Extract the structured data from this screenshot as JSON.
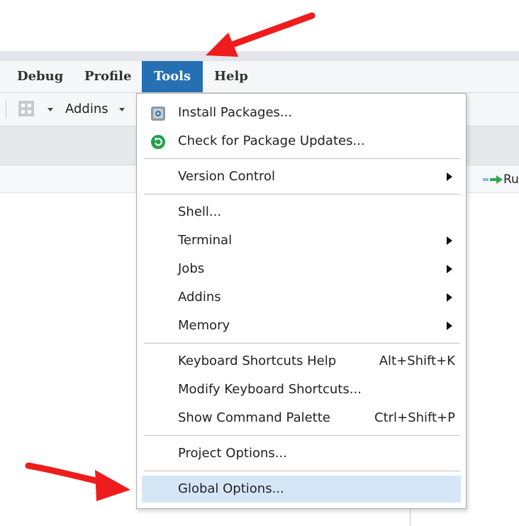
{
  "menubar": {
    "items": [
      {
        "label": "Debug"
      },
      {
        "label": "Profile"
      },
      {
        "label": "Tools",
        "active": true
      },
      {
        "label": "Help"
      }
    ]
  },
  "toolbar": {
    "addins_label": "Addins",
    "grid_icon": "grid-icon"
  },
  "panel": {
    "run_label": "Ru"
  },
  "tools_menu": {
    "install_packages": "Install Packages...",
    "check_updates": "Check for Package Updates...",
    "version_control": "Version Control",
    "shell": "Shell...",
    "terminal": "Terminal",
    "jobs": "Jobs",
    "addins": "Addins",
    "memory": "Memory",
    "keyboard_help": "Keyboard Shortcuts Help",
    "keyboard_help_shortcut": "Alt+Shift+K",
    "modify_shortcuts": "Modify Keyboard Shortcuts...",
    "command_palette": "Show Command Palette",
    "command_palette_shortcut": "Ctrl+Shift+P",
    "project_options": "Project Options...",
    "global_options": "Global Options...",
    "highlighted_item": "Global Options..."
  },
  "colors": {
    "active_menu": "#2470b3",
    "highlight": "#d5e7f7",
    "annotation_arrow": "#ee1c1c",
    "update_icon": "#22a14a"
  }
}
